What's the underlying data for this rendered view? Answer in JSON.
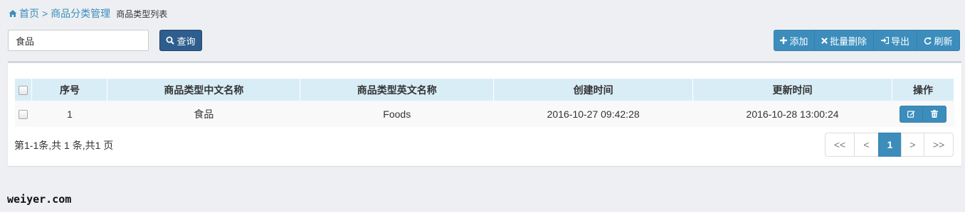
{
  "breadcrumb": {
    "home": "首页",
    "separator": ">",
    "category": "商品分类管理",
    "current": "商品类型列表"
  },
  "search": {
    "value": "食品",
    "button_label": "查询"
  },
  "toolbar": {
    "add": "添加",
    "batch_delete": "批量删除",
    "export": "导出",
    "refresh": "刷新"
  },
  "table": {
    "columns": [
      "序号",
      "商品类型中文名称",
      "商品类型英文名称",
      "创建时间",
      "更新时间",
      "操作"
    ],
    "rows": [
      {
        "index": "1",
        "name_cn": "食品",
        "name_en": "Foods",
        "created": "2016-10-27 09:42:28",
        "updated": "2016-10-28 13:00:24"
      }
    ]
  },
  "summary": "第1-1条,共 1 条,共1 页",
  "pagination": {
    "first": "<<",
    "prev": "<",
    "current": "1",
    "next": ">",
    "last": ">>"
  },
  "watermark": "weiyer.com",
  "colors": {
    "accent": "#3c8dbc",
    "query_button": "#2e5e8e",
    "header_bg": "#d9edf7",
    "page_bg": "#edeff2"
  }
}
